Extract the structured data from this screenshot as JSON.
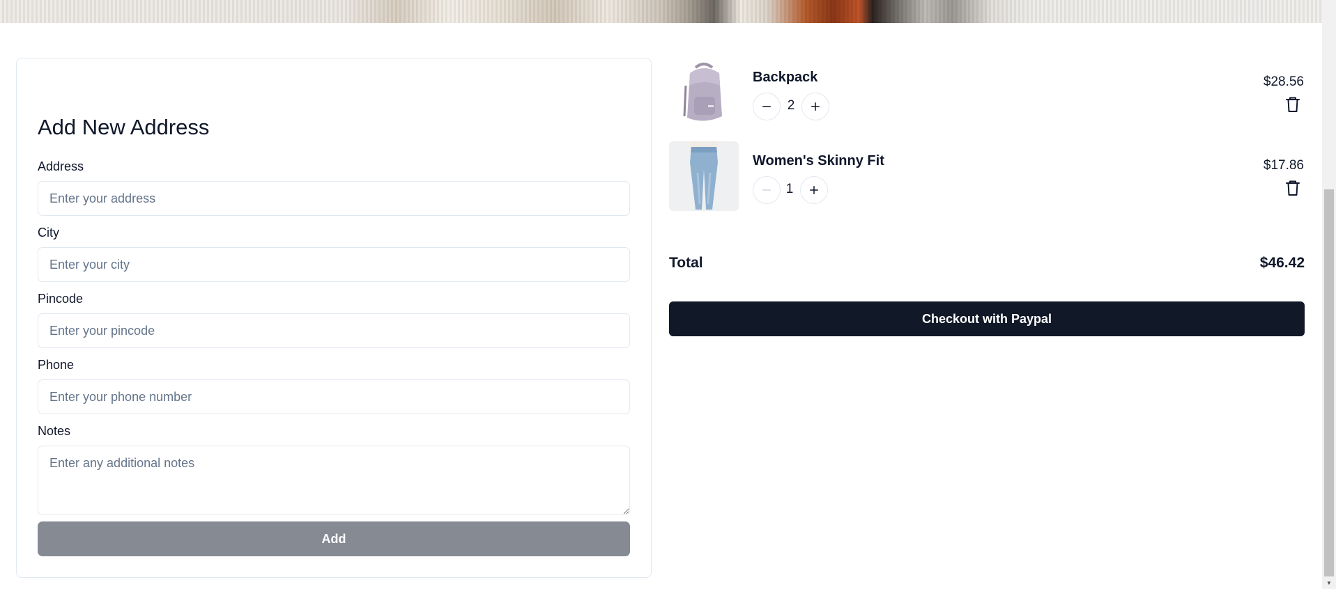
{
  "address_form": {
    "title": "Add New Address",
    "fields": {
      "address": {
        "label": "Address",
        "placeholder": "Enter your address"
      },
      "city": {
        "label": "City",
        "placeholder": "Enter your city"
      },
      "pincode": {
        "label": "Pincode",
        "placeholder": "Enter your pincode"
      },
      "phone": {
        "label": "Phone",
        "placeholder": "Enter your phone number"
      },
      "notes": {
        "label": "Notes",
        "placeholder": "Enter any additional notes"
      }
    },
    "submit_label": "Add"
  },
  "cart": {
    "items": [
      {
        "name": "Backpack",
        "quantity": "2",
        "price": "$28.56",
        "image_icon": "backpack-image"
      },
      {
        "name": "Women's Skinny Fit",
        "quantity": "1",
        "price": "$17.86",
        "image_icon": "jeans-image"
      }
    ],
    "total_label": "Total",
    "total_value": "$46.42",
    "checkout_label": "Checkout with Paypal"
  },
  "colors": {
    "primary": "#111827",
    "disabled_button": "#868a92",
    "border": "#e2e8f0",
    "placeholder": "#64748b"
  }
}
